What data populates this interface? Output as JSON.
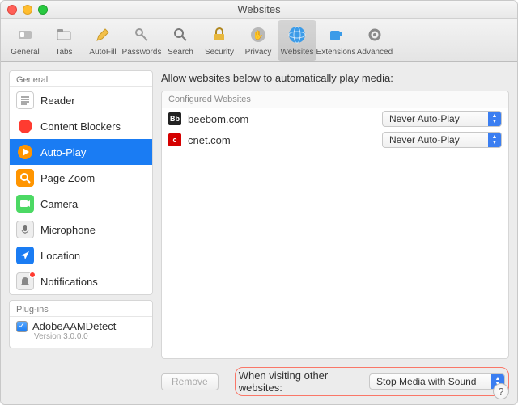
{
  "window": {
    "title": "Websites"
  },
  "toolbar": {
    "items": [
      {
        "label": "General"
      },
      {
        "label": "Tabs"
      },
      {
        "label": "AutoFill"
      },
      {
        "label": "Passwords"
      },
      {
        "label": "Search"
      },
      {
        "label": "Security"
      },
      {
        "label": "Privacy"
      },
      {
        "label": "Websites"
      },
      {
        "label": "Extensions"
      },
      {
        "label": "Advanced"
      }
    ],
    "selected": "Websites"
  },
  "sidebar": {
    "groups": {
      "general": {
        "title": "General",
        "items": [
          {
            "label": "Reader"
          },
          {
            "label": "Content Blockers"
          },
          {
            "label": "Auto-Play"
          },
          {
            "label": "Page Zoom"
          },
          {
            "label": "Camera"
          },
          {
            "label": "Microphone"
          },
          {
            "label": "Location"
          },
          {
            "label": "Notifications"
          }
        ]
      },
      "plugins": {
        "title": "Plug-ins",
        "item": {
          "label": "AdobeAAMDetect",
          "version": "Version 3.0.0.0",
          "enabled": true
        }
      }
    },
    "selected": "Auto-Play"
  },
  "main": {
    "instruction": "Allow websites below to automatically play media:",
    "box_title": "Configured Websites",
    "rows": [
      {
        "domain": "beebom.com",
        "setting": "Never Auto-Play",
        "favicon_bg": "#222",
        "favicon_txt": "Bb"
      },
      {
        "domain": "cnet.com",
        "setting": "Never Auto-Play",
        "favicon_bg": "#d40000",
        "favicon_txt": "c"
      }
    ]
  },
  "footer": {
    "remove_label": "Remove",
    "other_label": "When visiting other websites:",
    "other_value": "Stop Media with Sound"
  },
  "help": "?"
}
